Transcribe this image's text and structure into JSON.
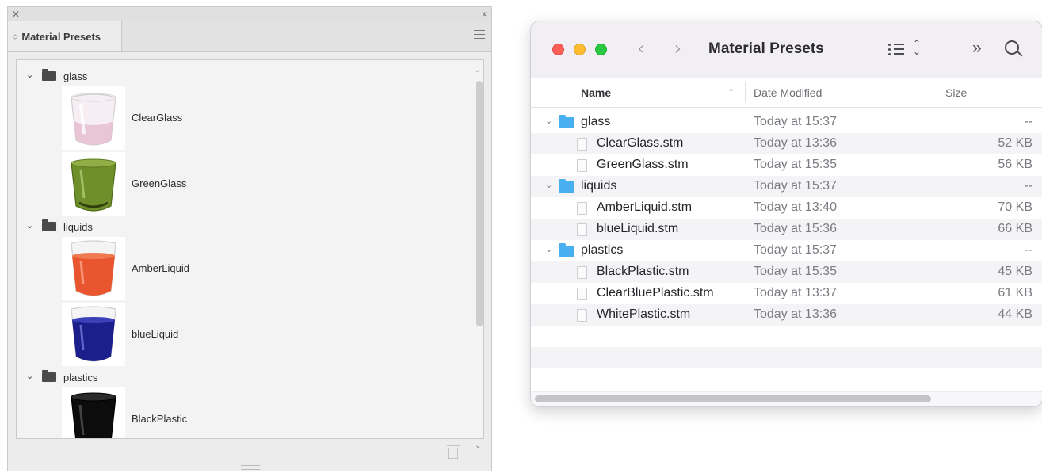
{
  "panel": {
    "title": "Material Presets",
    "folders": [
      {
        "name": "glass",
        "items": [
          {
            "label": "ClearGlass",
            "color": "#e7c1d3"
          },
          {
            "label": "GreenGlass",
            "color": "#6f8f2b"
          }
        ]
      },
      {
        "name": "liquids",
        "items": [
          {
            "label": "AmberLiquid",
            "color": "#e9552f"
          },
          {
            "label": "blueLiquid",
            "color": "#1b1f8c"
          }
        ]
      },
      {
        "name": "plastics",
        "items": [
          {
            "label": "BlackPlastic",
            "color": "#0c0c0c"
          }
        ]
      }
    ]
  },
  "finder": {
    "title": "Material Presets",
    "columns": {
      "name": "Name",
      "date": "Date Modified",
      "size": "Size"
    },
    "rows": [
      {
        "type": "folder",
        "name": "glass",
        "date": "Today at 15:37",
        "size": "--"
      },
      {
        "type": "file",
        "name": "ClearGlass.stm",
        "date": "Today at 13:36",
        "size": "52 KB"
      },
      {
        "type": "file",
        "name": "GreenGlass.stm",
        "date": "Today at 15:35",
        "size": "56 KB"
      },
      {
        "type": "folder",
        "name": "liquids",
        "date": "Today at 15:37",
        "size": "--"
      },
      {
        "type": "file",
        "name": "AmberLiquid.stm",
        "date": "Today at 13:40",
        "size": "70 KB"
      },
      {
        "type": "file",
        "name": "blueLiquid.stm",
        "date": "Today at 15:36",
        "size": "66 KB"
      },
      {
        "type": "folder",
        "name": "plastics",
        "date": "Today at 15:37",
        "size": "--"
      },
      {
        "type": "file",
        "name": "BlackPlastic.stm",
        "date": "Today at 15:35",
        "size": "45 KB"
      },
      {
        "type": "file",
        "name": "ClearBluePlastic.stm",
        "date": "Today at 13:37",
        "size": "61 KB"
      },
      {
        "type": "file",
        "name": "WhitePlastic.stm",
        "date": "Today at 13:36",
        "size": "44 KB"
      }
    ]
  }
}
